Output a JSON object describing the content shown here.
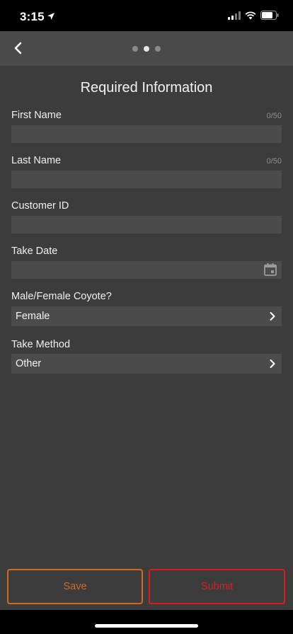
{
  "status_bar": {
    "time": "3:15"
  },
  "nav": {
    "page_count": 3,
    "active_page": 1
  },
  "form": {
    "title": "Required Information",
    "first_name": {
      "label": "First Name",
      "counter": "0/50",
      "value": ""
    },
    "last_name": {
      "label": "Last Name",
      "counter": "0/50",
      "value": ""
    },
    "customer_id": {
      "label": "Customer ID",
      "value": ""
    },
    "take_date": {
      "label": "Take Date",
      "value": ""
    },
    "sex": {
      "label": "Male/Female Coyote?",
      "value": "Female"
    },
    "take_method": {
      "label": "Take Method",
      "value": "Other"
    }
  },
  "footer": {
    "save_label": "Save",
    "submit_label": "Submit"
  },
  "colors": {
    "save": "#d2691e",
    "submit": "#e01b1b",
    "background": "#3c3c3c",
    "field": "#4b4b4b"
  }
}
